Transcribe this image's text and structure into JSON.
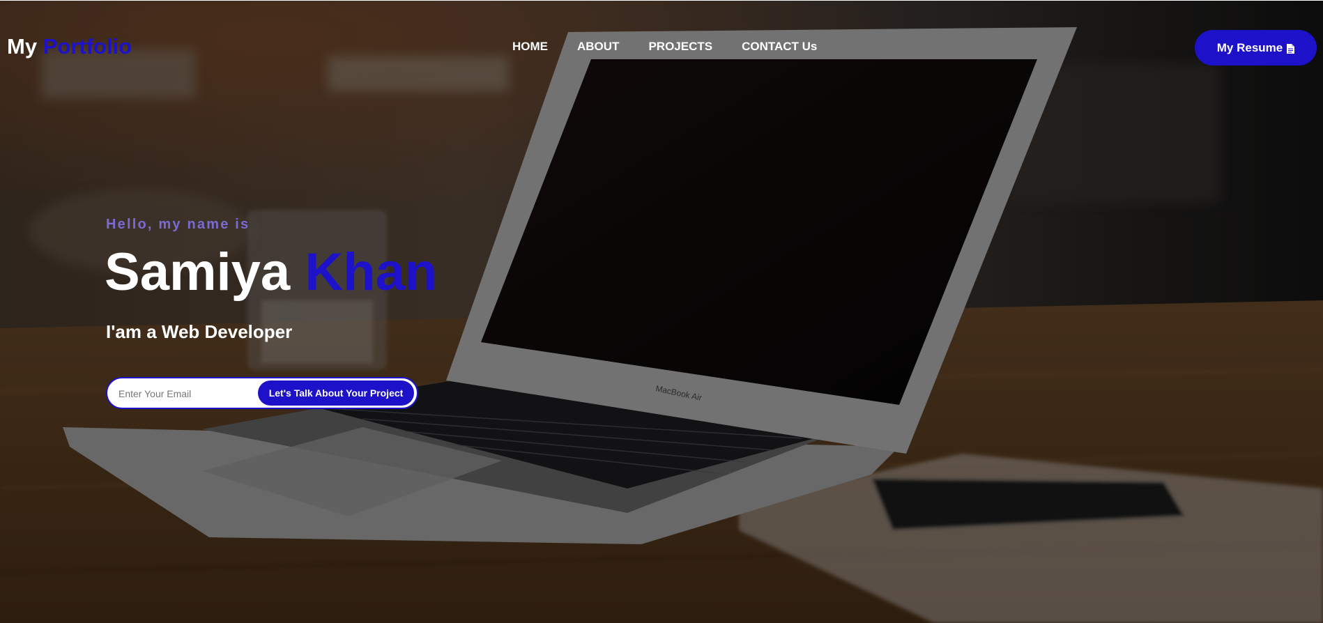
{
  "brand": {
    "logo_first": "My",
    "logo_second": "Portfolio"
  },
  "nav": {
    "items": [
      {
        "label": "HOME"
      },
      {
        "label": "ABOUT"
      },
      {
        "label": "PROJECTS"
      },
      {
        "label": "CONTACT Us"
      }
    ]
  },
  "header": {
    "resume_label": "My Resume",
    "resume_icon": "file-icon"
  },
  "intro": {
    "greeting": "Hello, my name is",
    "first_name": "Samiya",
    "last_name": "Khan",
    "role": "I'am a Web Developer"
  },
  "contact_form": {
    "email_placeholder": "Enter Your Email",
    "email_value": "",
    "submit_label": "Let's Talk About Your Project"
  },
  "colors": {
    "accent": "#1d12c9",
    "greeting": "#7a6bd4",
    "text": "#ffffff"
  }
}
